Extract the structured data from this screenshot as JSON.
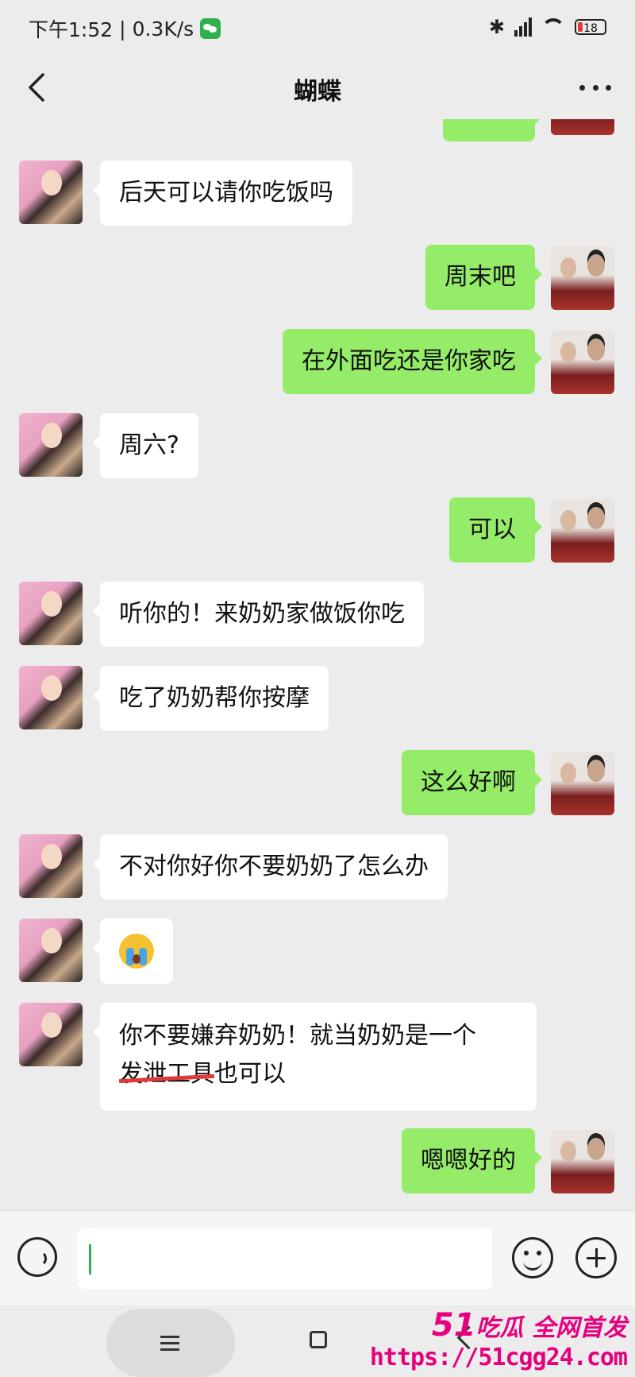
{
  "status_bar": {
    "time": "下午1:52",
    "speed": "0.3K/s",
    "battery": "18"
  },
  "header": {
    "title": "蝴蝶"
  },
  "messages": [
    {
      "side": "left",
      "text": "后天可以请你吃饭吗"
    },
    {
      "side": "right",
      "text": "周末吧"
    },
    {
      "side": "right",
      "text": "在外面吃还是你家吃"
    },
    {
      "side": "left",
      "text": "周六?"
    },
    {
      "side": "right",
      "text": "可以"
    },
    {
      "side": "left",
      "text": "听你的！来奶奶家做饭你吃"
    },
    {
      "side": "left",
      "text": "吃了奶奶帮你按摩"
    },
    {
      "side": "right",
      "text": "这么好啊"
    },
    {
      "side": "left",
      "text": "不对你好你不要奶奶了怎么办"
    },
    {
      "side": "left",
      "emoji": "crying-face-icon"
    },
    {
      "side": "left",
      "line1": "你不要嫌弃奶奶！就当奶奶是一个",
      "line2_struck": "发泄工具",
      "line2_rest": "也可以"
    },
    {
      "side": "right",
      "text": "嗯嗯好的"
    }
  ],
  "input": {
    "value": ""
  },
  "watermark": {
    "brand_num": "51",
    "brand_text": "吃瓜 全网首发",
    "url": "https://51cgg24.com"
  }
}
